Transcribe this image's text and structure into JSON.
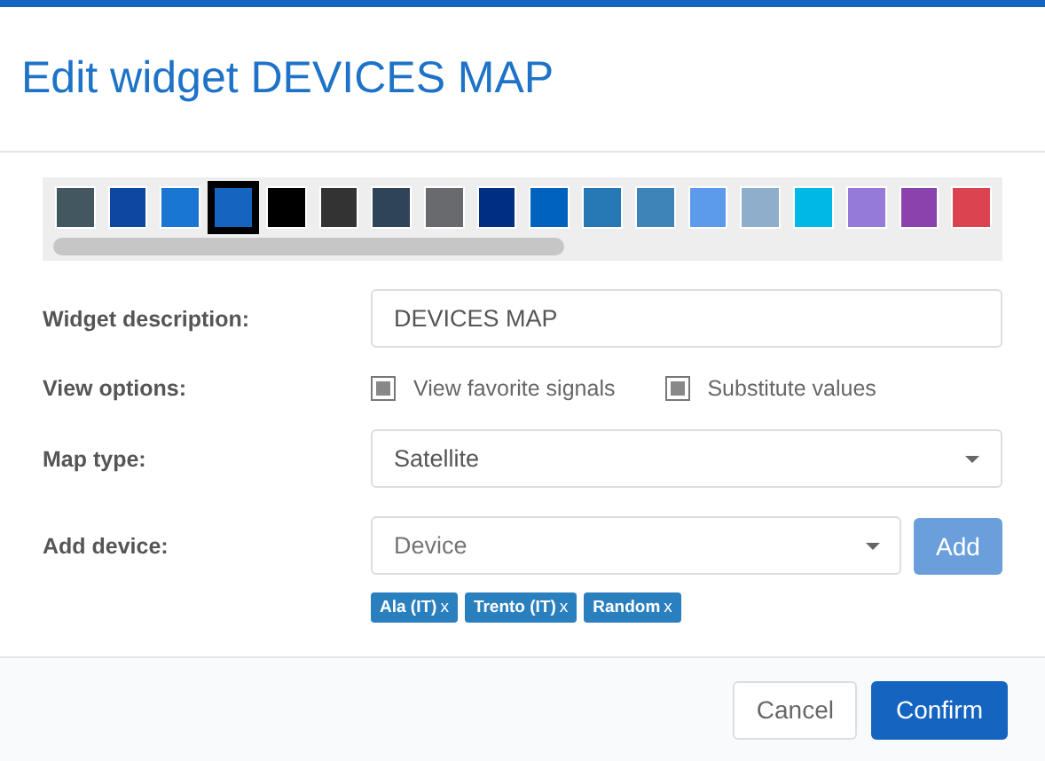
{
  "window": {
    "title": "Edit widget DEVICES MAP"
  },
  "palette": [
    {
      "color": "#435761",
      "selected": false
    },
    {
      "color": "#0d47a1",
      "selected": false
    },
    {
      "color": "#1976d2",
      "selected": false
    },
    {
      "color": "#1565c0",
      "selected": true
    },
    {
      "color": "#000000",
      "selected": false
    },
    {
      "color": "#333333",
      "selected": false
    },
    {
      "color": "#2f4359",
      "selected": false
    },
    {
      "color": "#696a6e",
      "selected": false
    },
    {
      "color": "#002e80",
      "selected": false
    },
    {
      "color": "#0062bf",
      "selected": false
    },
    {
      "color": "#2679b4",
      "selected": false
    },
    {
      "color": "#3e84b8",
      "selected": false
    },
    {
      "color": "#5c9aeb",
      "selected": false
    },
    {
      "color": "#8faecc",
      "selected": false
    },
    {
      "color": "#00b8e6",
      "selected": false
    },
    {
      "color": "#957ad9",
      "selected": false
    },
    {
      "color": "#8b42ad",
      "selected": false
    },
    {
      "color": "#db4351",
      "selected": false
    }
  ],
  "form": {
    "description": {
      "label": "Widget description:",
      "value": "DEVICES MAP"
    },
    "view_options": {
      "label": "View options:",
      "options": [
        {
          "label": "View favorite signals",
          "checked": true
        },
        {
          "label": "Substitute values",
          "checked": true
        }
      ]
    },
    "map_type": {
      "label": "Map type:",
      "value": "Satellite"
    },
    "add_device": {
      "label": "Add device:",
      "placeholder": "Device",
      "button": "Add"
    },
    "tags": [
      {
        "label": "Ala (IT)",
        "remove": "x"
      },
      {
        "label": "Trento (IT)",
        "remove": "x"
      },
      {
        "label": "Random",
        "remove": "x"
      }
    ]
  },
  "buttons": {
    "cancel": "Cancel",
    "confirm": "Confirm"
  }
}
